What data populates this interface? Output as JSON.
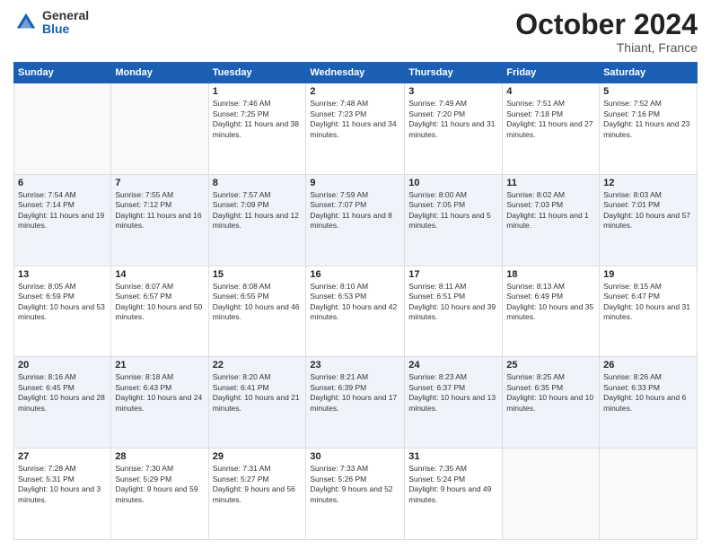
{
  "header": {
    "logo_general": "General",
    "logo_blue": "Blue",
    "month_title": "October 2024",
    "location": "Thiant, France"
  },
  "days_of_week": [
    "Sunday",
    "Monday",
    "Tuesday",
    "Wednesday",
    "Thursday",
    "Friday",
    "Saturday"
  ],
  "weeks": [
    [
      {
        "day": "",
        "info": ""
      },
      {
        "day": "",
        "info": ""
      },
      {
        "day": "1",
        "info": "Sunrise: 7:46 AM\nSunset: 7:25 PM\nDaylight: 11 hours and 38 minutes."
      },
      {
        "day": "2",
        "info": "Sunrise: 7:48 AM\nSunset: 7:23 PM\nDaylight: 11 hours and 34 minutes."
      },
      {
        "day": "3",
        "info": "Sunrise: 7:49 AM\nSunset: 7:20 PM\nDaylight: 11 hours and 31 minutes."
      },
      {
        "day": "4",
        "info": "Sunrise: 7:51 AM\nSunset: 7:18 PM\nDaylight: 11 hours and 27 minutes."
      },
      {
        "day": "5",
        "info": "Sunrise: 7:52 AM\nSunset: 7:16 PM\nDaylight: 11 hours and 23 minutes."
      }
    ],
    [
      {
        "day": "6",
        "info": "Sunrise: 7:54 AM\nSunset: 7:14 PM\nDaylight: 11 hours and 19 minutes."
      },
      {
        "day": "7",
        "info": "Sunrise: 7:55 AM\nSunset: 7:12 PM\nDaylight: 11 hours and 16 minutes."
      },
      {
        "day": "8",
        "info": "Sunrise: 7:57 AM\nSunset: 7:09 PM\nDaylight: 11 hours and 12 minutes."
      },
      {
        "day": "9",
        "info": "Sunrise: 7:59 AM\nSunset: 7:07 PM\nDaylight: 11 hours and 8 minutes."
      },
      {
        "day": "10",
        "info": "Sunrise: 8:00 AM\nSunset: 7:05 PM\nDaylight: 11 hours and 5 minutes."
      },
      {
        "day": "11",
        "info": "Sunrise: 8:02 AM\nSunset: 7:03 PM\nDaylight: 11 hours and 1 minute."
      },
      {
        "day": "12",
        "info": "Sunrise: 8:03 AM\nSunset: 7:01 PM\nDaylight: 10 hours and 57 minutes."
      }
    ],
    [
      {
        "day": "13",
        "info": "Sunrise: 8:05 AM\nSunset: 6:59 PM\nDaylight: 10 hours and 53 minutes."
      },
      {
        "day": "14",
        "info": "Sunrise: 8:07 AM\nSunset: 6:57 PM\nDaylight: 10 hours and 50 minutes."
      },
      {
        "day": "15",
        "info": "Sunrise: 8:08 AM\nSunset: 6:55 PM\nDaylight: 10 hours and 46 minutes."
      },
      {
        "day": "16",
        "info": "Sunrise: 8:10 AM\nSunset: 6:53 PM\nDaylight: 10 hours and 42 minutes."
      },
      {
        "day": "17",
        "info": "Sunrise: 8:11 AM\nSunset: 6:51 PM\nDaylight: 10 hours and 39 minutes."
      },
      {
        "day": "18",
        "info": "Sunrise: 8:13 AM\nSunset: 6:49 PM\nDaylight: 10 hours and 35 minutes."
      },
      {
        "day": "19",
        "info": "Sunrise: 8:15 AM\nSunset: 6:47 PM\nDaylight: 10 hours and 31 minutes."
      }
    ],
    [
      {
        "day": "20",
        "info": "Sunrise: 8:16 AM\nSunset: 6:45 PM\nDaylight: 10 hours and 28 minutes."
      },
      {
        "day": "21",
        "info": "Sunrise: 8:18 AM\nSunset: 6:43 PM\nDaylight: 10 hours and 24 minutes."
      },
      {
        "day": "22",
        "info": "Sunrise: 8:20 AM\nSunset: 6:41 PM\nDaylight: 10 hours and 21 minutes."
      },
      {
        "day": "23",
        "info": "Sunrise: 8:21 AM\nSunset: 6:39 PM\nDaylight: 10 hours and 17 minutes."
      },
      {
        "day": "24",
        "info": "Sunrise: 8:23 AM\nSunset: 6:37 PM\nDaylight: 10 hours and 13 minutes."
      },
      {
        "day": "25",
        "info": "Sunrise: 8:25 AM\nSunset: 6:35 PM\nDaylight: 10 hours and 10 minutes."
      },
      {
        "day": "26",
        "info": "Sunrise: 8:26 AM\nSunset: 6:33 PM\nDaylight: 10 hours and 6 minutes."
      }
    ],
    [
      {
        "day": "27",
        "info": "Sunrise: 7:28 AM\nSunset: 5:31 PM\nDaylight: 10 hours and 3 minutes."
      },
      {
        "day": "28",
        "info": "Sunrise: 7:30 AM\nSunset: 5:29 PM\nDaylight: 9 hours and 59 minutes."
      },
      {
        "day": "29",
        "info": "Sunrise: 7:31 AM\nSunset: 5:27 PM\nDaylight: 9 hours and 56 minutes."
      },
      {
        "day": "30",
        "info": "Sunrise: 7:33 AM\nSunset: 5:26 PM\nDaylight: 9 hours and 52 minutes."
      },
      {
        "day": "31",
        "info": "Sunrise: 7:35 AM\nSunset: 5:24 PM\nDaylight: 9 hours and 49 minutes."
      },
      {
        "day": "",
        "info": ""
      },
      {
        "day": "",
        "info": ""
      }
    ]
  ]
}
